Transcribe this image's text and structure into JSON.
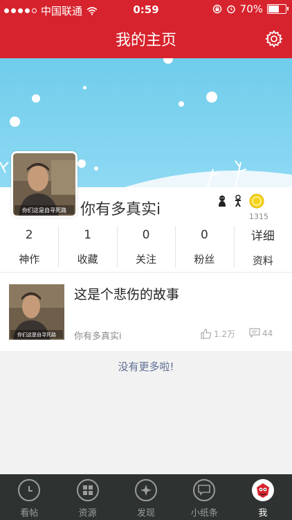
{
  "status_bar": {
    "carrier": "中国联通",
    "time": "0:59",
    "battery": "70%",
    "battery_level": 0.7
  },
  "nav": {
    "title": "我的主页"
  },
  "profile": {
    "username": "你有多真实i",
    "score": "1315",
    "avatar_caption": "你们这是自寻死路"
  },
  "stats": [
    {
      "num": "2",
      "label": "神作"
    },
    {
      "num": "1",
      "label": "收藏"
    },
    {
      "num": "0",
      "label": "关注"
    },
    {
      "num": "0",
      "label": "粉丝"
    },
    {
      "num": "详细",
      "label": "资料"
    }
  ],
  "post": {
    "title": "这是个悲伤的故事",
    "author": "你有多真实i",
    "likes": "1.2万",
    "comments": "44",
    "thumb_caption": "你们这是自寻死路"
  },
  "no_more": "没有更多啦!",
  "tabs": [
    {
      "label": "看帖",
      "icon": "clock-icon"
    },
    {
      "label": "资源",
      "icon": "grid-icon"
    },
    {
      "label": "发现",
      "icon": "compass-icon"
    },
    {
      "label": "小纸条",
      "icon": "message-icon"
    },
    {
      "label": "我",
      "icon": "avatar-icon"
    }
  ],
  "colors": {
    "brand_red": "#d7232d",
    "tab_bar": "#2e3332",
    "link_blue": "#5c6e92"
  }
}
